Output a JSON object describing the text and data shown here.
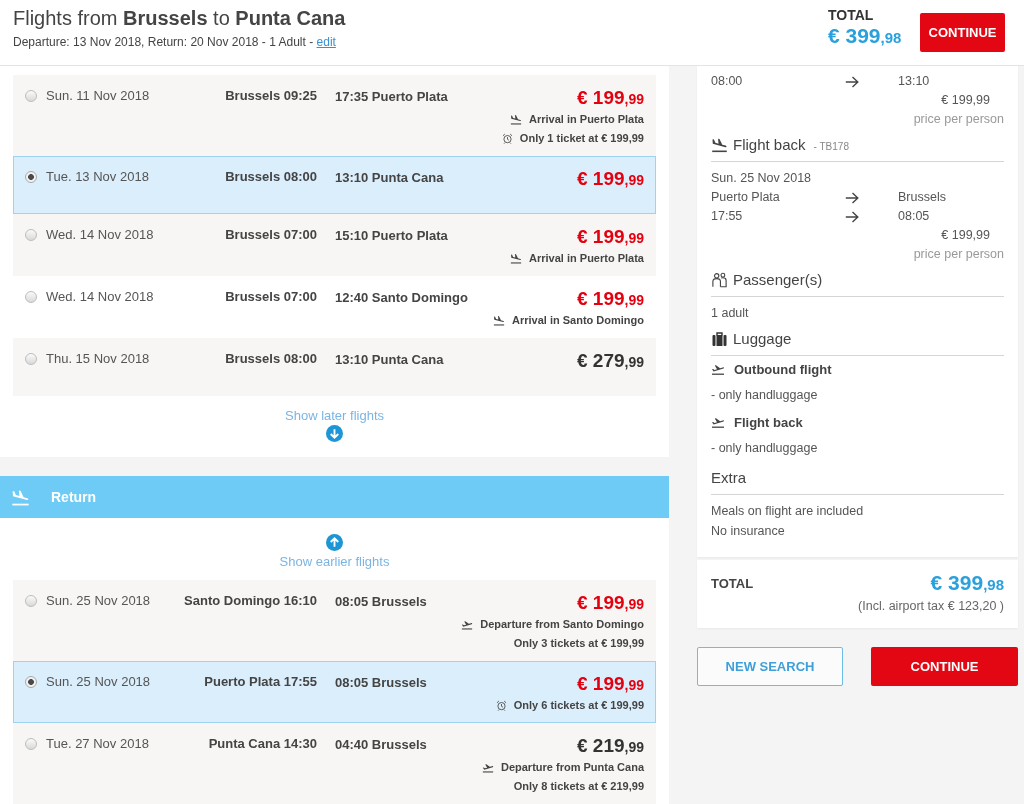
{
  "header": {
    "title": "Flights from **Brussels** to **Punta Cana**",
    "subtitle": "Departure: 13 Nov 2018, Return: 20 Nov 2018 - 1 Adult -",
    "edit_link": "edit",
    "total_label": "TOTAL",
    "total_price": "€ 399,98",
    "continue_button": "CONTINUE"
  },
  "outbound": {
    "flights": [
      {
        "date": "Sun. 11 Nov 2018",
        "departure": "Brussels 09:25",
        "arrival": "17:35 Puerto Plata",
        "price": "€ 199,99",
        "highlighted": true,
        "selected": false,
        "notes": [
          {
            "kind": "arrival",
            "text": "Arrival in Puerto Plata"
          },
          {
            "kind": "alarm",
            "text": "Only 1 ticket at € 199,99"
          }
        ]
      },
      {
        "date": "Tue. 13 Nov 2018",
        "departure": "Brussels 08:00",
        "arrival": "13:10 Punta Cana",
        "price": "€ 199,99",
        "highlighted": true,
        "selected": true
      },
      {
        "date": "Wed. 14 Nov 2018",
        "departure": "Brussels 07:00",
        "arrival": "15:10 Puerto Plata",
        "price": "€ 199,99",
        "highlighted": true,
        "selected": false,
        "notes": [
          {
            "kind": "arrival",
            "text": "Arrival in Puerto Plata"
          }
        ]
      },
      {
        "date": "Wed. 14 Nov 2018",
        "departure": "Brussels 07:00",
        "arrival": "12:40 Santo Domingo",
        "price": "€ 199,99",
        "highlighted": true,
        "selected": false,
        "notes": [
          {
            "kind": "arrival",
            "text": "Arrival in Santo Domingo"
          }
        ]
      },
      {
        "date": "Thu. 15 Nov 2018",
        "departure": "Brussels 08:00",
        "arrival": "13:10 Punta Cana",
        "price": "€ 279,99",
        "highlighted": false,
        "selected": false
      }
    ],
    "show_later": "Show later flights"
  },
  "return": {
    "title": "Return",
    "show_earlier": "Show earlier flights",
    "flights": [
      {
        "date": "Sun. 25 Nov 2018",
        "departure": "Santo Domingo 16:10",
        "arrival": "08:05 Brussels",
        "price": "€ 199,99",
        "highlighted": true,
        "selected": false,
        "notes": [
          {
            "kind": "departure",
            "text": "Departure from Santo Domingo"
          },
          {
            "kind": "plain",
            "text": "Only 3 tickets at € 199,99"
          }
        ]
      },
      {
        "date": "Sun. 25 Nov 2018",
        "departure": "Puerto Plata 17:55",
        "arrival": "08:05 Brussels",
        "price": "€ 199,99",
        "highlighted": true,
        "selected": true,
        "notes": [
          {
            "kind": "alarm",
            "text": "Only 6 tickets at € 199,99"
          }
        ]
      },
      {
        "date": "Tue. 27 Nov 2018",
        "departure": "Punta Cana 14:30",
        "arrival": "04:40 Brussels",
        "price": "€ 219,99",
        "highlighted": false,
        "selected": false,
        "notes": [
          {
            "kind": "departure",
            "text": "Departure from Punta Cana"
          },
          {
            "kind": "plain",
            "text": "Only 8 tickets at € 219,99"
          }
        ]
      }
    ]
  },
  "summary": {
    "outbound_partial": {
      "legs": [
        {
          "from": "08:00",
          "to": "13:10"
        }
      ],
      "price": "€ 199,99",
      "price_note": "price per person"
    },
    "flight_back": {
      "title": "Flight back",
      "code": "- TB178",
      "date": "Sun. 25 Nov 2018",
      "legs": [
        {
          "from": "Puerto Plata",
          "to": "Brussels"
        },
        {
          "from": "17:55",
          "to": "08:05"
        }
      ],
      "price": "€ 199,99",
      "price_note": "price per person"
    },
    "passengers": {
      "title": "Passenger(s)",
      "lines": [
        "1 adult"
      ]
    },
    "luggage": {
      "title": "Luggage",
      "items": [
        {
          "title": "Outbound flight",
          "detail": "- only handluggage"
        },
        {
          "title": "Flight back",
          "detail": "- only handluggage"
        }
      ]
    },
    "extra": {
      "title": "Extra",
      "lines": [
        "Meals on flight are included",
        "No insurance"
      ]
    },
    "total": {
      "label": "TOTAL",
      "price": "€ 399,98",
      "tax_note": "(Incl. airport tax € 123,20 )"
    }
  },
  "actions": {
    "new_search": "NEW SEARCH",
    "continue": "CONTINUE"
  }
}
